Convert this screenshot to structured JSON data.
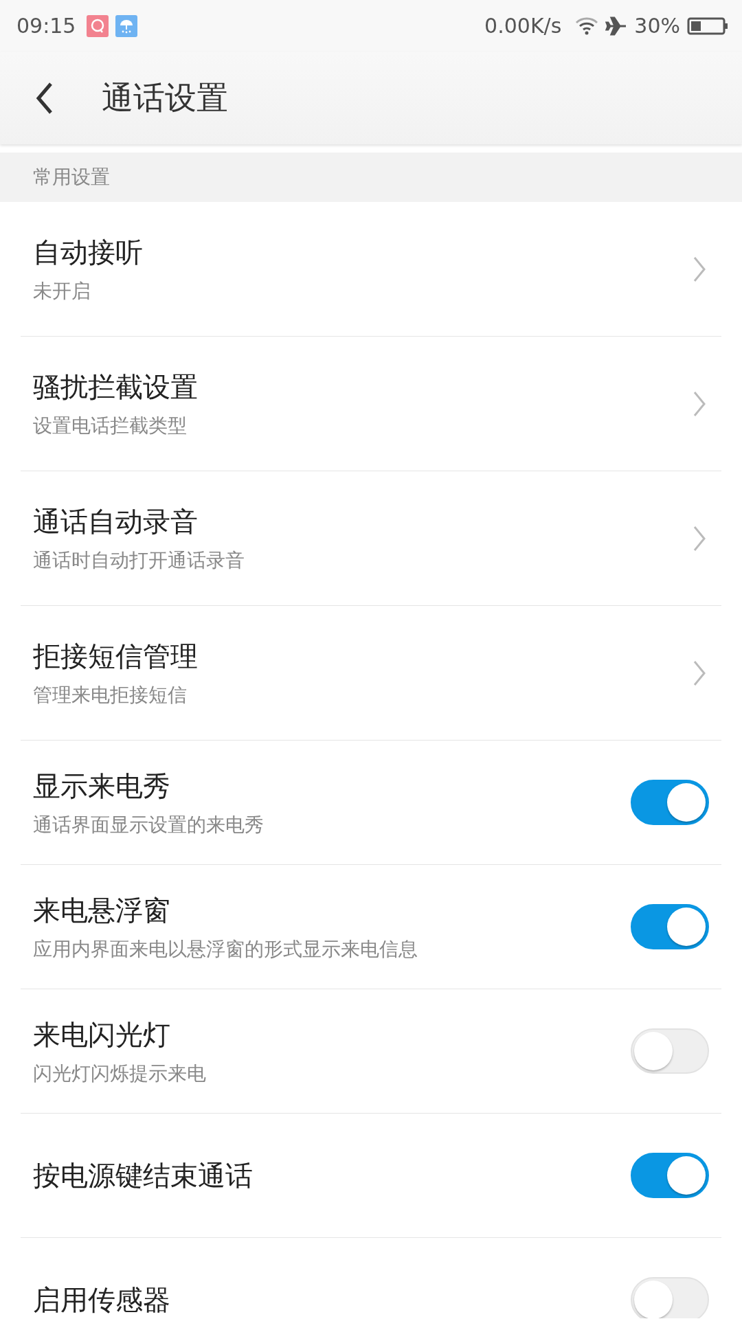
{
  "status_bar": {
    "time": "09:15",
    "speed": "0.00K/s",
    "battery": "30%"
  },
  "title_bar": {
    "title": "通话设置"
  },
  "section": {
    "title": "常用设置"
  },
  "items": [
    {
      "kind": "link",
      "title": "自动接听",
      "subtitle": "未开启"
    },
    {
      "kind": "link",
      "title": "骚扰拦截设置",
      "subtitle": "设置电话拦截类型"
    },
    {
      "kind": "link",
      "title": "通话自动录音",
      "subtitle": "通话时自动打开通话录音"
    },
    {
      "kind": "link",
      "title": "拒接短信管理",
      "subtitle": "管理来电拒接短信"
    },
    {
      "kind": "toggle",
      "title": "显示来电秀",
      "subtitle": "通话界面显示设置的来电秀",
      "on": true
    },
    {
      "kind": "toggle",
      "title": "来电悬浮窗",
      "subtitle": "应用内界面来电以悬浮窗的形式显示来电信息",
      "on": true
    },
    {
      "kind": "toggle",
      "title": "来电闪光灯",
      "subtitle": "闪光灯闪烁提示来电",
      "on": false
    },
    {
      "kind": "toggle",
      "title": "按电源键结束通话",
      "on": true
    },
    {
      "kind": "toggle",
      "title": "启用传感器",
      "on": false
    }
  ]
}
